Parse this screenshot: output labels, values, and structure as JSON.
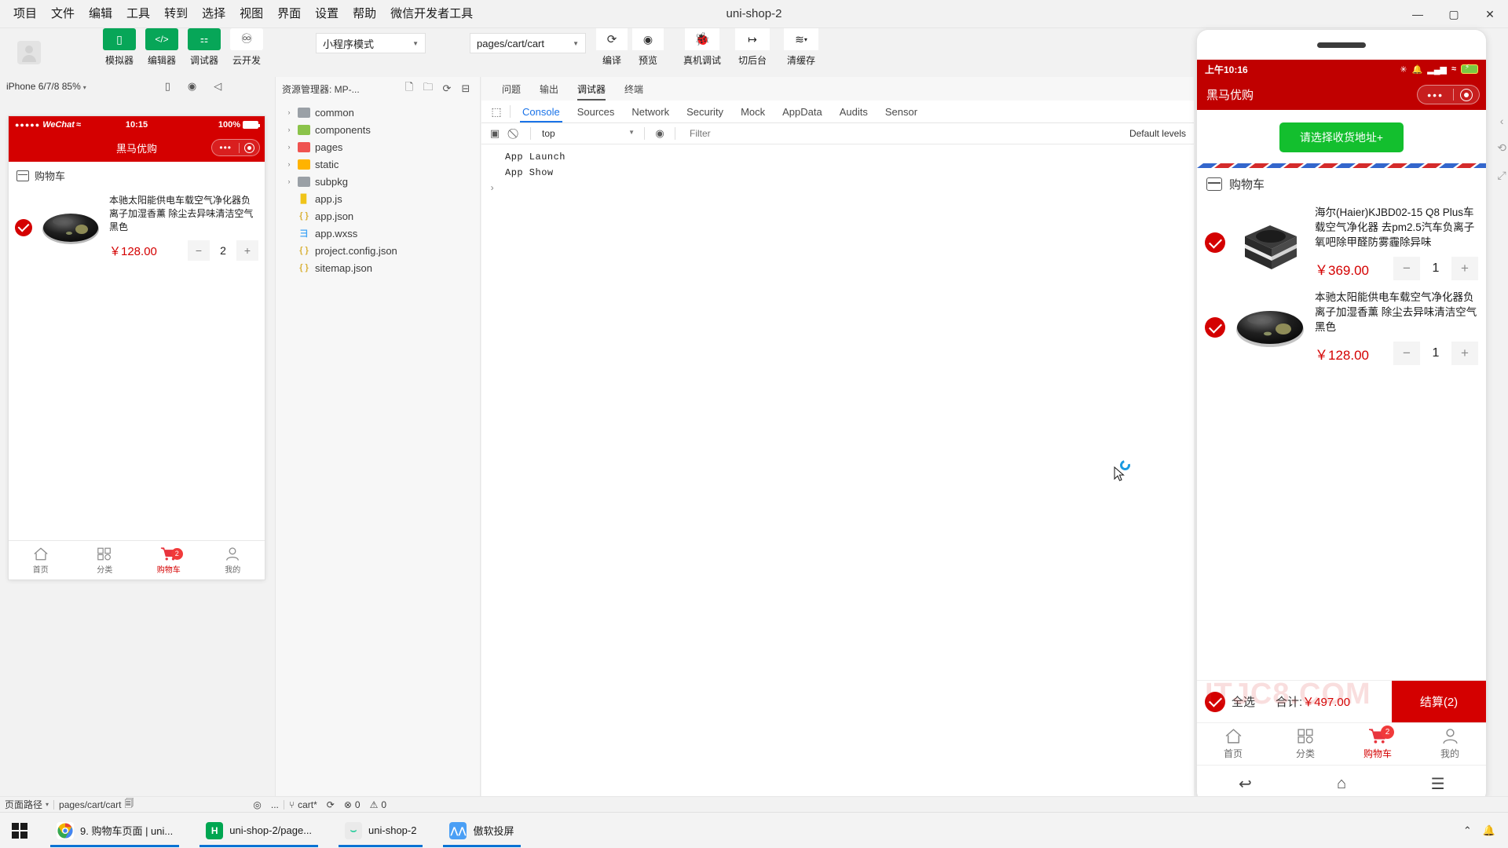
{
  "window": {
    "title": "uni-shop-2",
    "menus": [
      "项目",
      "文件",
      "编辑",
      "工具",
      "转到",
      "选择",
      "视图",
      "界面",
      "设置",
      "帮助",
      "微信开发者工具"
    ],
    "controls": {
      "minimize": "—",
      "maximize": "▢",
      "close": "✕"
    }
  },
  "toolbar": {
    "modes": [
      {
        "label": "模拟器",
        "icon": "phone-icon",
        "style": "green"
      },
      {
        "label": "编辑器",
        "icon": "code-icon",
        "style": "green"
      },
      {
        "label": "调试器",
        "icon": "debug-icon",
        "style": "green"
      },
      {
        "label": "云开发",
        "icon": "cloud-icon",
        "style": "white"
      }
    ],
    "mode_select": {
      "value": "小程序模式",
      "caret": "▼"
    },
    "page_select": {
      "value": "pages/cart/cart",
      "caret": "▼"
    },
    "compile": {
      "label": "编译",
      "icon": "refresh-icon"
    },
    "preview": {
      "label": "预览",
      "icon": "eye-icon"
    },
    "real_debug": {
      "label": "真机调试",
      "icon": "bug-icon"
    },
    "background": {
      "label": "切后台",
      "icon": "switch-icon"
    },
    "clear_cache": {
      "label": "清缓存",
      "icon": "layers-icon",
      "caret": "▾"
    }
  },
  "simulator": {
    "device": "iPhone 6/7/8 85%",
    "caret": "▾",
    "icons": [
      "rotate-icon",
      "record-icon",
      "volume-icon"
    ],
    "phone": {
      "status": {
        "carrier": "WeChat",
        "dots": "●●●●●",
        "wifi": "≈",
        "time": "10:15",
        "battery": "100%"
      },
      "navbar": {
        "title": "黑马优购",
        "dots": "•••"
      },
      "cart_header": "购物车",
      "items": [
        {
          "name": "本驰太阳能供电车载空气净化器负离子加湿香薰 除尘去异味清洁空气黑色",
          "price": "￥128.00",
          "qty": "2",
          "minus": "−",
          "plus": "+",
          "checked": true
        }
      ],
      "tabs": [
        {
          "label": "首页",
          "icon": "home-icon",
          "active": false,
          "badge": ""
        },
        {
          "label": "分类",
          "icon": "category-icon",
          "active": false,
          "badge": ""
        },
        {
          "label": "购物车",
          "icon": "cart-icon",
          "active": true,
          "badge": "2"
        },
        {
          "label": "我的",
          "icon": "user-icon",
          "active": false,
          "badge": ""
        }
      ]
    }
  },
  "explorer": {
    "title": "资源管理器: MP-...",
    "actions": [
      "new-file-icon",
      "new-folder-icon",
      "refresh-icon",
      "collapse-icon"
    ],
    "tree": [
      {
        "name": "common",
        "type": "folder",
        "twisty": "›",
        "color": "#9aa0a6"
      },
      {
        "name": "components",
        "type": "folder",
        "twisty": "›",
        "color": "#8bc34a"
      },
      {
        "name": "pages",
        "type": "folder",
        "twisty": "›",
        "color": "#ef5350"
      },
      {
        "name": "static",
        "type": "folder",
        "twisty": "›",
        "color": "#ffb300"
      },
      {
        "name": "subpkg",
        "type": "folder",
        "twisty": "›",
        "color": "#9aa0a6"
      },
      {
        "name": "app.js",
        "type": "file",
        "glyph": "▉",
        "color": "#f0c419"
      },
      {
        "name": "app.json",
        "type": "file",
        "glyph": "{ }",
        "color": "#f0c419"
      },
      {
        "name": "app.wxss",
        "type": "file",
        "glyph": "彐",
        "color": "#42a5f5"
      },
      {
        "name": "project.config.json",
        "type": "file",
        "glyph": "{ }",
        "color": "#f0c419"
      },
      {
        "name": "sitemap.json",
        "type": "file",
        "glyph": "{ }",
        "color": "#f0c419"
      }
    ]
  },
  "devtools": {
    "panel_tabs": [
      {
        "label": "问题",
        "active": false
      },
      {
        "label": "输出",
        "active": false
      },
      {
        "label": "调试器",
        "active": true
      },
      {
        "label": "终端",
        "active": false
      }
    ],
    "inspect_icon": "inspect-icon",
    "tabs": [
      {
        "label": "Console",
        "active": true
      },
      {
        "label": "Sources",
        "active": false
      },
      {
        "label": "Network",
        "active": false
      },
      {
        "label": "Security",
        "active": false
      },
      {
        "label": "Mock",
        "active": false
      },
      {
        "label": "AppData",
        "active": false
      },
      {
        "label": "Audits",
        "active": false
      },
      {
        "label": "Sensor",
        "active": false
      }
    ],
    "console_bar": {
      "execute_icon": "execute-icon",
      "clear_icon": "clear-icon",
      "context": "top",
      "caret": "▼",
      "eye_icon": "eye-icon",
      "filter_placeholder": "Filter",
      "levels": "Default levels"
    },
    "logs": [
      "App  Launch",
      "App  Show"
    ],
    "prompt": "›"
  },
  "mirror": {
    "status": {
      "time": "上午10:16",
      "bluetooth": "✳",
      "mute": "🔕",
      "signal": "▂▄▆",
      "wifi": "≈"
    },
    "navbar": {
      "title": "黑马优购",
      "dots": "•••"
    },
    "address_button": "请选择收货地址+",
    "cart_header": "购物车",
    "items": [
      {
        "name": "海尔(Haier)KJBD02-15 Q8 Plus车载空气净化器 去pm2.5汽车负离子氧吧除甲醛防雾霾除异味",
        "price": "￥369.00",
        "qty": "1",
        "minus": "−",
        "plus": "+",
        "checked": true,
        "image": "air-purifier-box"
      },
      {
        "name": "本驰太阳能供电车载空气净化器负离子加湿香薰 除尘去异味清洁空气黑色",
        "price": "￥128.00",
        "qty": "1",
        "minus": "−",
        "plus": "+",
        "checked": true,
        "image": "air-purifier-disc"
      }
    ],
    "watermark": "ITJC8.COM",
    "settle": {
      "select_all": "全选",
      "total_label": "合计:",
      "total_amount": "￥497.00",
      "checkout": "结算(2)"
    },
    "tabs": [
      {
        "label": "首页",
        "icon": "home-icon",
        "active": false,
        "badge": ""
      },
      {
        "label": "分类",
        "icon": "category-icon",
        "active": false,
        "badge": ""
      },
      {
        "label": "购物车",
        "icon": "cart-icon",
        "active": true,
        "badge": "2"
      },
      {
        "label": "我的",
        "icon": "user-icon",
        "active": false,
        "badge": ""
      }
    ],
    "sysnav": [
      "back-icon",
      "home-icon",
      "menu-icon"
    ],
    "side_icons": [
      "chevron-left-icon",
      "rotate-icon",
      "expand-icon"
    ]
  },
  "statusbar": {
    "path_label": "页面路径",
    "caret": "▾",
    "path_value": "pages/cart/cart",
    "copy_icon": "copy-icon",
    "eye_icon": "eye-icon",
    "more": "...",
    "branch_icon": "branch-icon",
    "branch": "cart*",
    "sync_icon": "sync-icon",
    "errors": "0",
    "warnings": "0"
  },
  "taskbar": {
    "start_icon": "windows-icon",
    "items": [
      {
        "label": "9. 购物车页面 | uni...",
        "icon": "chrome-icon",
        "color": "#ffffff",
        "glyph": "◉",
        "active": true
      },
      {
        "label": "uni-shop-2/page...",
        "icon": "hbuilder-icon",
        "color": "#00a651",
        "glyph": "H",
        "active": true
      },
      {
        "label": "uni-shop-2",
        "icon": "wechat-devtool-icon",
        "color": "#f2f2f2",
        "glyph": "◠",
        "active": true
      },
      {
        "label": "傲软投屏",
        "icon": "apowermirror-icon",
        "color": "#4a9ff5",
        "glyph": "M",
        "active": true
      }
    ],
    "tray": [
      "chevron-up-icon",
      "notification-icon"
    ]
  }
}
